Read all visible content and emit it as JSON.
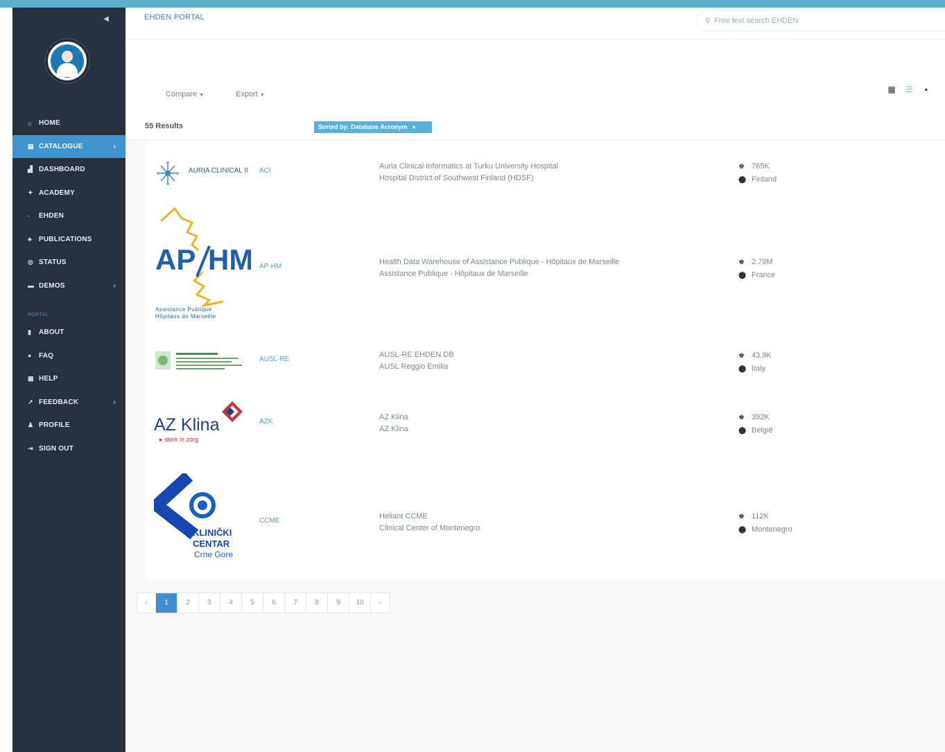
{
  "sidebar": {
    "collapse_icon": "double-chevron-left-icon",
    "items": [
      {
        "label": "HOME",
        "icon": "home-icon",
        "glyph": "⌂",
        "active": false,
        "has_arrow": false
      },
      {
        "label": "CATALOGUE",
        "icon": "book-icon",
        "glyph": "▤",
        "active": true,
        "has_arrow": true
      },
      {
        "label": "DASHBOARD",
        "icon": "dashboard-icon",
        "glyph": "▟",
        "active": false,
        "has_arrow": false
      },
      {
        "label": "ACADEMY",
        "icon": "graduation-cap-icon",
        "glyph": "✦",
        "active": false,
        "has_arrow": false
      },
      {
        "label": "EHDEN",
        "icon": "ehden-icon",
        "glyph": "·",
        "active": false,
        "has_arrow": false
      },
      {
        "label": "PUBLICATIONS",
        "icon": "publications-icon",
        "glyph": "♣",
        "active": false,
        "has_arrow": false
      },
      {
        "label": "STATUS",
        "icon": "status-search-icon",
        "glyph": "◎",
        "active": false,
        "has_arrow": false
      },
      {
        "label": "DEMOS",
        "icon": "folder-icon",
        "glyph": "▬",
        "active": false,
        "has_arrow": true
      }
    ],
    "section_label": "PORTAL",
    "portal_items": [
      {
        "label": "ABOUT",
        "icon": "bookmark-icon",
        "glyph": "▮",
        "has_arrow": false
      },
      {
        "label": "FAQ",
        "icon": "question-icon",
        "glyph": "●",
        "has_arrow": false
      },
      {
        "label": "HELP",
        "icon": "help-book-icon",
        "glyph": "▦",
        "has_arrow": false
      },
      {
        "label": "FEEDBACK",
        "icon": "feedback-icon",
        "glyph": "↗",
        "has_arrow": true
      },
      {
        "label": "PROFILE",
        "icon": "user-icon",
        "glyph": "♟",
        "has_arrow": false
      },
      {
        "label": "SIGN OUT",
        "icon": "sign-out-icon",
        "glyph": "⇥",
        "has_arrow": false
      }
    ]
  },
  "header": {
    "brand": "EHDEN PORTAL",
    "search_placeholder": "Free text search EHDEN"
  },
  "toolbar": {
    "compare_label": "Compare",
    "export_label": "Export",
    "views": [
      "list-detail-view-icon",
      "list-view-icon",
      "grid-view-icon"
    ],
    "active_view": 1
  },
  "results": {
    "count_label": "55 Results",
    "sort_label": "Sorted by: Database Acronym"
  },
  "rows": [
    {
      "logo": "AURIA CLINICAL INFORMATICS",
      "acronym": "ACI",
      "name": "Auria Clinical Informatics at Turku University Hospital",
      "org": "Hospital District of Southwest Finland (HDSF)",
      "patients": "765K",
      "country": "Finland"
    },
    {
      "logo": "APHM Assistance Publique Hôpitaux de Marseille",
      "acronym": "AP-HM",
      "name": "Health Data Warehouse of Assistance Publique - Hôpitaux de Marseille",
      "org": "Assistance Publique - Hôpitaux de Marseille",
      "patients": "2.79M",
      "country": "France"
    },
    {
      "logo": "AUSL-RE logo",
      "acronym": "AUSL-RE",
      "name": "AUSL-RE EHDEN DB",
      "org": "AUSL Reggio Emilia",
      "patients": "43.9K",
      "country": "Italy"
    },
    {
      "logo": "AZ Klina",
      "logo_tagline": "▸ sterk in zorg",
      "acronym": "AZK",
      "name": "AZ Klina",
      "org": "AZ Klina",
      "patients": "392K",
      "country": "België"
    },
    {
      "logo": "KLINIČKI CENTAR Crne Gore",
      "acronym": "CCME",
      "name": "Heliant CCME",
      "org": "Clinical Center of Montenegro",
      "patients": "112K",
      "country": "Montenegro"
    }
  ],
  "pagination": {
    "prev": "‹",
    "next": "›",
    "pages": [
      "1",
      "2",
      "3",
      "4",
      "5",
      "6",
      "7",
      "8",
      "9",
      "10"
    ],
    "current": "1"
  },
  "colors": {
    "accent": "#3f94cf",
    "sidebar_bg": "#26303f",
    "top_bar": "#5aaec8",
    "link": "#5b9ad3"
  }
}
